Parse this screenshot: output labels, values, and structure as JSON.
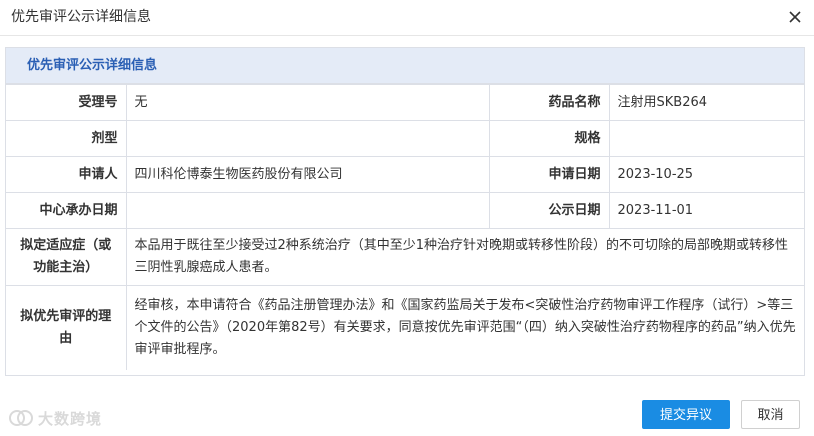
{
  "dialog": {
    "title": "优先审评公示详细信息",
    "close_icon": "close-icon"
  },
  "panel": {
    "title": "优先审评公示详细信息"
  },
  "fields": {
    "acceptance_no_label": "受理号",
    "acceptance_no_value": "无",
    "drug_name_label": "药品名称",
    "drug_name_value": "注射用SKB264",
    "dosage_form_label": "剂型",
    "dosage_form_value": "",
    "spec_label": "规格",
    "spec_value": "",
    "applicant_label": "申请人",
    "applicant_value": "四川科伦博泰生物医药股份有限公司",
    "apply_date_label": "申请日期",
    "apply_date_value": "2023-10-25",
    "center_date_label": "中心承办日期",
    "center_date_value": "",
    "publish_date_label": "公示日期",
    "publish_date_value": "2023-11-01",
    "indication_label": "拟定适应症（或功能主治）",
    "indication_value": "本品用于既往至少接受过2种系统治疗（其中至少1种治疗针对晚期或转移性阶段）的不可切除的局部晚期或转移性三阴性乳腺癌成人患者。",
    "reason_label": "拟优先审评的理由",
    "reason_value": "经审核，本申请符合《药品注册管理办法》和《国家药监局关于发布<突破性治疗药物审评工作程序（试行）>等三个文件的公告》（2020年第82号）有关要求，同意按优先审评范围“（四）纳入突破性治疗药物程序的药品”纳入优先审评审批程序。"
  },
  "buttons": {
    "submit_objection": "提交异议",
    "cancel": "取消"
  },
  "watermark": {
    "text": "大数跨境",
    "icon": "watermark-logo-icon"
  },
  "colors": {
    "panel_header_bg": "#e4ebf7",
    "panel_title": "#2a5fb4",
    "primary_button": "#1a8ce3",
    "border": "#dcdfe6"
  }
}
